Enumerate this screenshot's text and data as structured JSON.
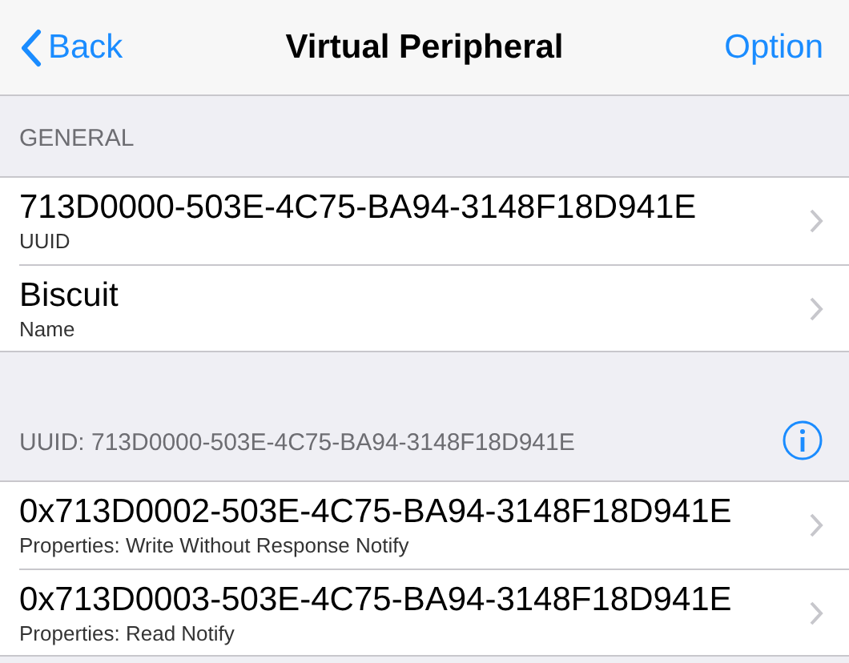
{
  "nav": {
    "back": "Back",
    "title": "Virtual Peripheral",
    "option": "Option"
  },
  "sections": [
    {
      "header": "GENERAL",
      "info": false,
      "rows": [
        {
          "title": "713D0000-503E-4C75-BA94-3148F18D941E",
          "subtitle": "UUID"
        },
        {
          "title": "Biscuit",
          "subtitle": "Name"
        }
      ]
    },
    {
      "header": "UUID: 713D0000-503E-4C75-BA94-3148F18D941E",
      "info": true,
      "rows": [
        {
          "title": "0x713D0002-503E-4C75-BA94-3148F18D941E",
          "subtitle": "Properties: Write Without Response Notify"
        },
        {
          "title": "0x713D0003-503E-4C75-BA94-3148F18D941E",
          "subtitle": "Properties: Read Notify"
        }
      ]
    }
  ]
}
